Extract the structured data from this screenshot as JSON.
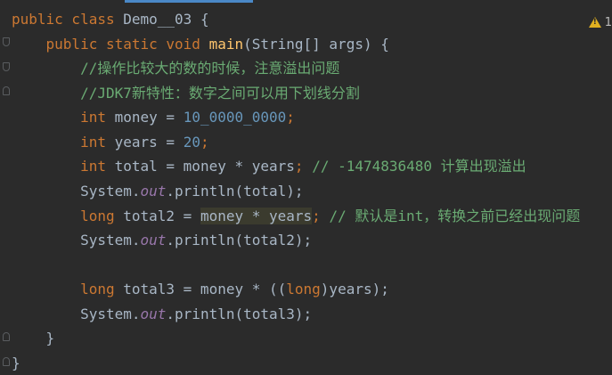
{
  "editor": {
    "warning_count": "1"
  },
  "code": {
    "l1": {
      "kw": "public class",
      "name": "Demo__03",
      "brace": "{"
    },
    "l2": {
      "kw": "public static void",
      "fn": "main",
      "params": "(String[] args) {"
    },
    "l3": {
      "comment": "//操作比较大的数的时候，注意溢出问题"
    },
    "l4": {
      "comment": "//JDK7新特性：数字之间可以用下划线分割"
    },
    "l5": {
      "type": "int",
      "name": "money",
      "eq": "=",
      "value": "10_0000_0000",
      "semi": ";"
    },
    "l6": {
      "type": "int",
      "name": "years",
      "eq": "=",
      "value": "20",
      "semi": ";"
    },
    "l7": {
      "type": "int",
      "expr": "total = money * years",
      "semi": ";",
      "comment": "// -1474836480 计算出现溢出"
    },
    "l8": {
      "cls": "System.",
      "field": "out",
      "call": ".println(total);"
    },
    "l9": {
      "type": "long",
      "lhs": "total2 =",
      "expr": "money * years",
      "semi": ";",
      "comment": "// 默认是int，转换之前已经出现问题"
    },
    "l10": {
      "cls": "System.",
      "field": "out",
      "call": ".println(total2);"
    },
    "l11": {
      "type": "long",
      "a": "total3 = money * ((",
      "cast": "long",
      "b": ")years);"
    },
    "l12": {
      "cls": "System.",
      "field": "out",
      "call": ".println(total3);"
    },
    "l13": {
      "brace": "}"
    },
    "l14": {
      "brace": "}"
    }
  }
}
